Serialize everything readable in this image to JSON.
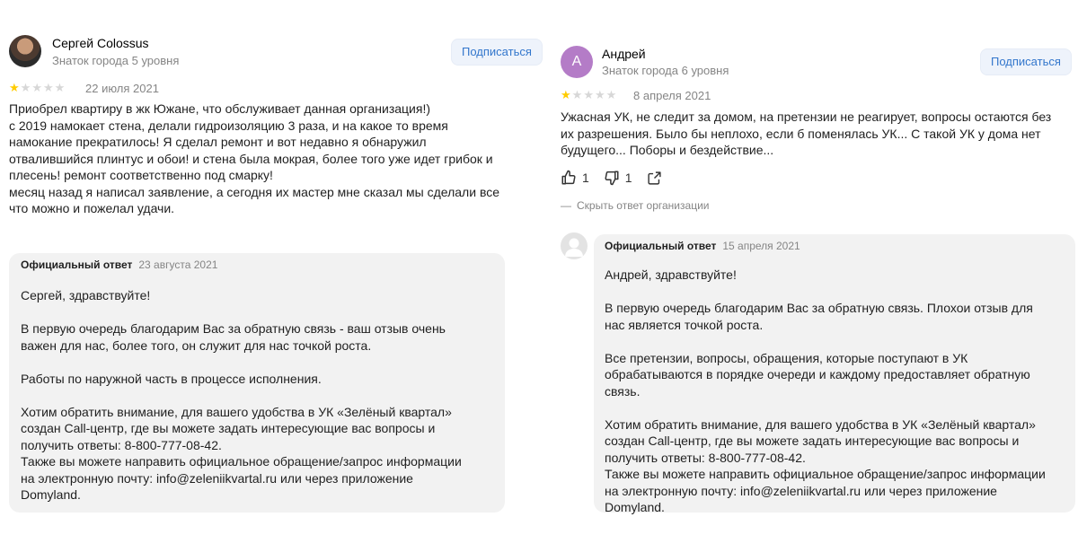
{
  "left": {
    "author": "Сергей Colossus",
    "level": "Знаток города 5 уровня",
    "subscribe_label": "Подписаться",
    "rating": 1,
    "date": "22 июля 2021",
    "text": "Приобрел квартиру в жк Южане, что обслуживает данная организация!)\nс 2019 намокает стена, делали гидроизоляцию 3 раза, и на какое то время\nнамокание прекратилось! Я сделал ремонт и вот недавно я обнаружил\nотвалившийся плинтус и обои! и стена была мокрая, более того уже идет грибок и\nплесень! ремонт соответственно под смарку!\nмесяц назад я написал заявление, а сегодня их мастер мне сказал мы сделали все\nчто можно и пожелал удачи.",
    "reply": {
      "title": "Официальный ответ",
      "date": "23 августа 2021",
      "text": "Сергей, здравствуйте!\n\nВ первую очередь благодарим Вас за обратную связь - ваш отзыв очень\nважен для нас, более того, он служит для нас точкой роста.\n\nРаботы по наружной часть в процессе исполнения.\n\nХотим обратить внимание, для вашего удобства в УК «Зелёный квартал»\nсоздан Call-центр, где вы можете задать интересующие вас вопросы и\nполучить ответы: 8-800-777-08-42.\nТакже вы можете направить официальное обращение/запрос информации\nна электронную почту: info@zeleniikvartal.ru или через приложение\nDomyland."
    }
  },
  "right": {
    "author": "Андрей",
    "avatar_letter": "А",
    "level": "Знаток города 6 уровня",
    "subscribe_label": "Подписаться",
    "rating": 1,
    "date": "8 апреля 2021",
    "text": "Ужасная УК, не следит за домом, на претензии не реагирует, вопросы остаются без\nих разрешения. Было бы неплохо, если б поменялась УК... С такой УК у дома нет\nбудущего... Поборы и бездействие...",
    "likes": "1",
    "dislikes": "1",
    "hide_reply_label": "Скрыть ответ организации",
    "reply": {
      "title": "Официальный ответ",
      "date": "15 апреля 2021",
      "text": "Андрей, здравствуйте!\n\nВ первую очередь благодарим Вас за обратную связь. Плохои отзыв для\nнас является точкой роста.\n\nВсе претензии, вопросы, обращения, которые поступают в УК\nобрабатываются в порядке очереди и каждому предоставляет обратную\nсвязь.\n\nХотим обратить внимание, для вашего удобства в УК «Зелёный квартал»\nсоздан Call-центр, где вы можете задать интересующие вас вопросы и\nполучить ответы: 8-800-777-08-42.\nТакже вы можете направить официальное обращение/запрос информации\nна электронную почту: info@zeleniikvartal.ru или через приложение\nDomyland."
    }
  },
  "colors": {
    "star_on": "#ffcc00",
    "star_off": "#d7d7d7",
    "subscribe_text": "#3276cc",
    "reply_bg": "#f2f2f2"
  },
  "icons": {
    "star": "star-icon",
    "like": "thumb-up-icon",
    "dislike": "thumb-down-icon",
    "share": "share-icon",
    "org_avatar": "user-placeholder-icon"
  }
}
